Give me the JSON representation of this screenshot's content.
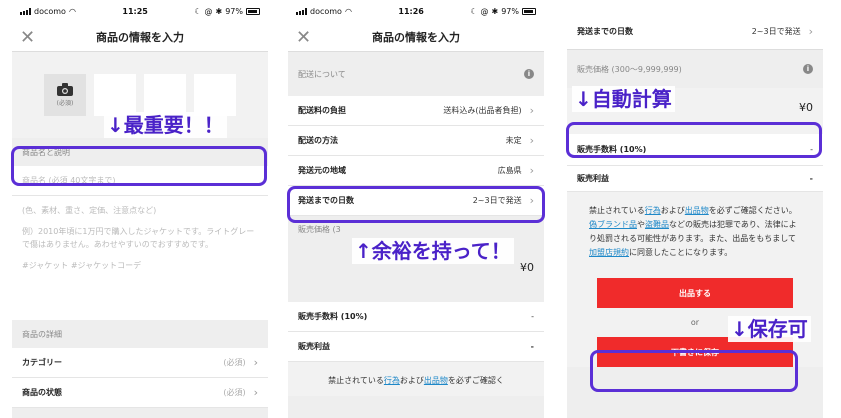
{
  "status": {
    "carrier": "docomo",
    "time1": "11:25",
    "time2": "11:26",
    "battery": "97%"
  },
  "nav": {
    "title": "商品の情報を入力",
    "close": "✕"
  },
  "p1": {
    "cam_label": "(必須)",
    "name_section": "商品名と説明",
    "name_placeholder": "商品名 (必須 40文字まで)",
    "desc_lines": [
      "(色、素材、重さ、定価、注意点など)",
      "例）2010年頃に1万円で購入したジャケットです。ライトグレーで傷はありません。あわせやすいのでおすすめです。",
      "#ジャケット #ジャケットコーデ"
    ],
    "details_section": "商品の詳細",
    "rows": [
      {
        "label": "カテゴリー",
        "value": "(必須)"
      },
      {
        "label": "商品の状態",
        "value": "(必須)"
      }
    ]
  },
  "p2": {
    "shipping_section": "配送について",
    "rows": [
      {
        "label": "配送料の負担",
        "value": "送料込み(出品者負担)"
      },
      {
        "label": "配送の方法",
        "value": "未定"
      },
      {
        "label": "発送元の地域",
        "value": "広島県"
      },
      {
        "label": "発送までの日数",
        "value": "2~3日で発送"
      }
    ],
    "price_section": "販売価格 (3",
    "price_value": "¥0",
    "fee_label": "販売手数料 (10%)",
    "fee_value": "-",
    "profit_label": "販売利益",
    "profit_value": "-",
    "notice": [
      "禁止されている",
      "行為",
      "および",
      "出品物",
      "を必ずご確認く"
    ]
  },
  "p3": {
    "days_label": "発送までの日数",
    "days_value": "2~3日で発送",
    "price_section": "販売価格 (300～9,999,999)",
    "price_value": "¥0",
    "fee_label": "販売手数料 (10%)",
    "fee_value": "-",
    "profit_label": "販売利益",
    "profit_value": "-",
    "notice": {
      "t1": "禁止されている",
      "l1": "行為",
      "t2": "および",
      "l2": "出品物",
      "t3": "を必ずご確認ください。",
      "l3": "偽ブランド品",
      "t4": "や",
      "l4": "盗難品",
      "t5": "などの販売は犯罪であり、法律により処罰される可能性があります。また、出品をもちまして",
      "l5": "加盟店規約",
      "t6": "に同意したことになります。"
    },
    "list_button": "出品する",
    "or": "or",
    "draft_button": "下書きに保存"
  },
  "annotations": {
    "a1": "↓最重要！！",
    "a2": "↑余裕を持って！",
    "a3": "↓自動計算",
    "a4": "↓保存可"
  },
  "colors": {
    "highlight": "#5b2fd6",
    "annotation": "#4a22c8",
    "red_button": "#f02b2b",
    "link": "#1e88c8"
  }
}
